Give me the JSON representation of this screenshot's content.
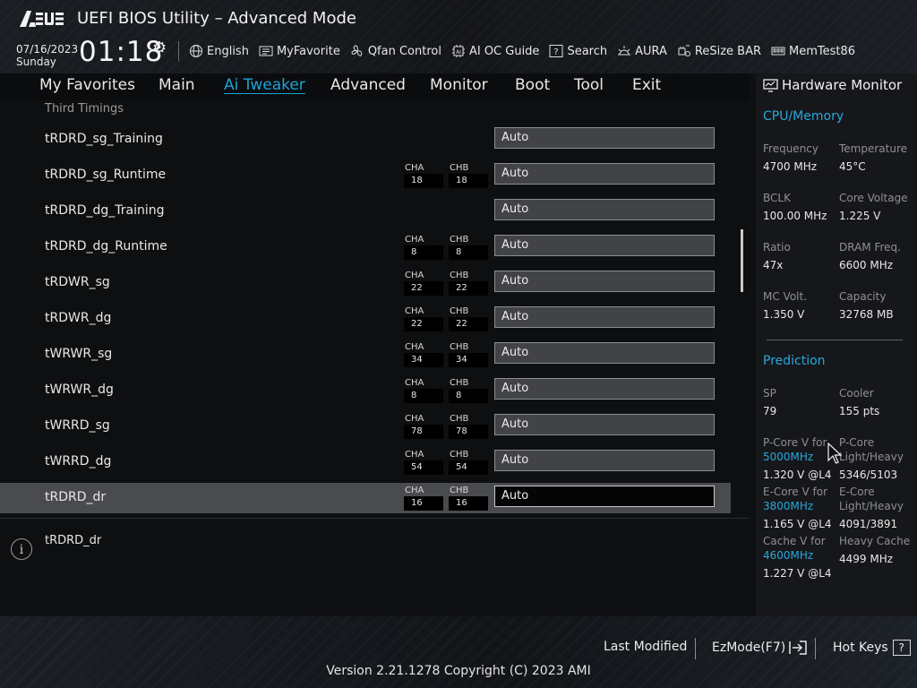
{
  "header": {
    "logo_text": "ASUS",
    "title": "UEFI BIOS Utility – Advanced Mode",
    "date": "07/16/2023",
    "day": "Sunday",
    "time": "01:18",
    "toolbar": [
      {
        "label": "English",
        "icon": "globe-icon"
      },
      {
        "label": "MyFavorite",
        "icon": "favorite-list-icon"
      },
      {
        "label": "Qfan Control",
        "icon": "fan-icon"
      },
      {
        "label": "AI OC Guide",
        "icon": "ai-chip-icon"
      },
      {
        "label": "Search",
        "icon": "search-question-icon"
      },
      {
        "label": "AURA",
        "icon": "aura-light-icon"
      },
      {
        "label": "ReSize BAR",
        "icon": "resize-bar-icon"
      },
      {
        "label": "MemTest86",
        "icon": "memory-test-icon"
      }
    ]
  },
  "nav": {
    "tabs": [
      "My Favorites",
      "Main",
      "Ai Tweaker",
      "Advanced",
      "Monitor",
      "Boot",
      "Tool",
      "Exit"
    ],
    "active": "Ai Tweaker"
  },
  "main": {
    "section_title": "Third Timings",
    "channel_a_label": "CHA",
    "channel_b_label": "CHB",
    "rows": [
      {
        "label": "tRDRD_sg_Training",
        "cha": null,
        "chb": null,
        "value": "Auto"
      },
      {
        "label": "tRDRD_sg_Runtime",
        "cha": "18",
        "chb": "18",
        "value": "Auto"
      },
      {
        "label": "tRDRD_dg_Training",
        "cha": null,
        "chb": null,
        "value": "Auto"
      },
      {
        "label": "tRDRD_dg_Runtime",
        "cha": "8",
        "chb": "8",
        "value": "Auto"
      },
      {
        "label": "tRDWR_sg",
        "cha": "22",
        "chb": "22",
        "value": "Auto"
      },
      {
        "label": "tRDWR_dg",
        "cha": "22",
        "chb": "22",
        "value": "Auto"
      },
      {
        "label": "tWRWR_sg",
        "cha": "34",
        "chb": "34",
        "value": "Auto"
      },
      {
        "label": "tWRWR_dg",
        "cha": "8",
        "chb": "8",
        "value": "Auto"
      },
      {
        "label": "tWRRD_sg",
        "cha": "78",
        "chb": "78",
        "value": "Auto"
      },
      {
        "label": "tWRRD_dg",
        "cha": "54",
        "chb": "54",
        "value": "Auto"
      },
      {
        "label": "tRDRD_dr",
        "cha": "16",
        "chb": "16",
        "value": "Auto",
        "selected": true
      }
    ]
  },
  "help": {
    "text": "tRDRD_dr"
  },
  "hw_monitor": {
    "title": "Hardware Monitor",
    "cpu_memory": {
      "title": "CPU/Memory",
      "frequency_label": "Frequency",
      "frequency": "4700 MHz",
      "temperature_label": "Temperature",
      "temperature": "45°C",
      "bclk_label": "BCLK",
      "bclk": "100.00 MHz",
      "core_voltage_label": "Core Voltage",
      "core_voltage": "1.225 V",
      "ratio_label": "Ratio",
      "ratio": "47x",
      "dram_freq_label": "DRAM Freq.",
      "dram_freq": "6600 MHz",
      "mc_volt_label": "MC Volt.",
      "mc_volt": "1.350 V",
      "capacity_label": "Capacity",
      "capacity": "32768 MB"
    },
    "prediction": {
      "title": "Prediction",
      "sp_label": "SP",
      "sp": "79",
      "cooler_label": "Cooler",
      "cooler": "155 pts",
      "pcore_v_label": "P-Core V for",
      "pcore_v_freq": "5000MHz",
      "pcore_v": "1.320 V @L4",
      "pcore_lh_label_1": "P-Core",
      "pcore_lh_label_2": "Light/Heavy",
      "pcore_lh": "5346/5103",
      "ecore_v_label": "E-Core V for",
      "ecore_v_freq": "3800MHz",
      "ecore_v": "1.165 V @L4",
      "ecore_lh_label_1": "E-Core",
      "ecore_lh_label_2": "Light/Heavy",
      "ecore_lh": "4091/3891",
      "cache_v_label": "Cache V for",
      "cache_v_freq": "4600MHz",
      "cache_v": "1.227 V @L4",
      "heavy_cache_label": "Heavy Cache",
      "heavy_cache": "4499 MHz"
    }
  },
  "footer": {
    "last_modified": "Last Modified",
    "ezmode": "EzMode(F7)",
    "hot_keys": "Hot Keys",
    "hot_keys_icon": "?",
    "version": "Version 2.21.1278 Copyright (C) 2023 AMI"
  },
  "colors": {
    "accent": "#1fa4d6",
    "selected_row": "#4a4b4e",
    "field_bg": "#424346"
  }
}
